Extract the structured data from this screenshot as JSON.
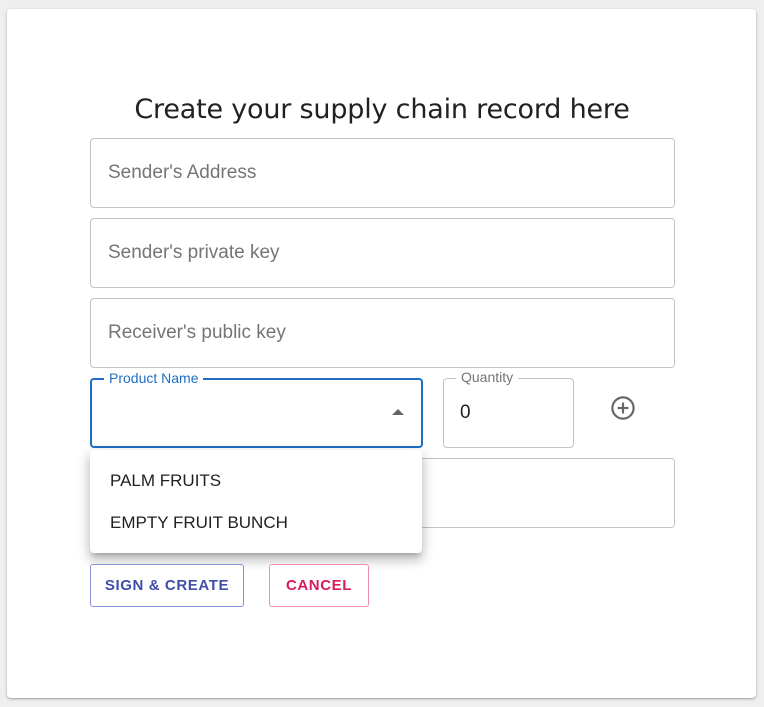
{
  "form": {
    "title": "Create your supply chain record here",
    "sender_address_placeholder": "Sender's Address",
    "sender_private_key_placeholder": "Sender's private key",
    "receiver_public_key_placeholder": "Receiver's public key",
    "product_name_label": "Product Name",
    "product_name_value": "",
    "quantity_label": "Quantity",
    "quantity_value": "0"
  },
  "product_menu": {
    "options": [
      "PALM FRUITS",
      "EMPTY FRUIT BUNCH"
    ]
  },
  "actions": {
    "sign_create_label": "SIGN & CREATE",
    "cancel_label": "CANCEL"
  },
  "icons": {
    "add": "add-circle-outline-icon",
    "dropdown": "arrow-drop-up-icon"
  },
  "colors": {
    "focus_blue": "#1e6fc3",
    "primary_text": "#3f4ea8",
    "secondary_text": "#d81b60"
  }
}
